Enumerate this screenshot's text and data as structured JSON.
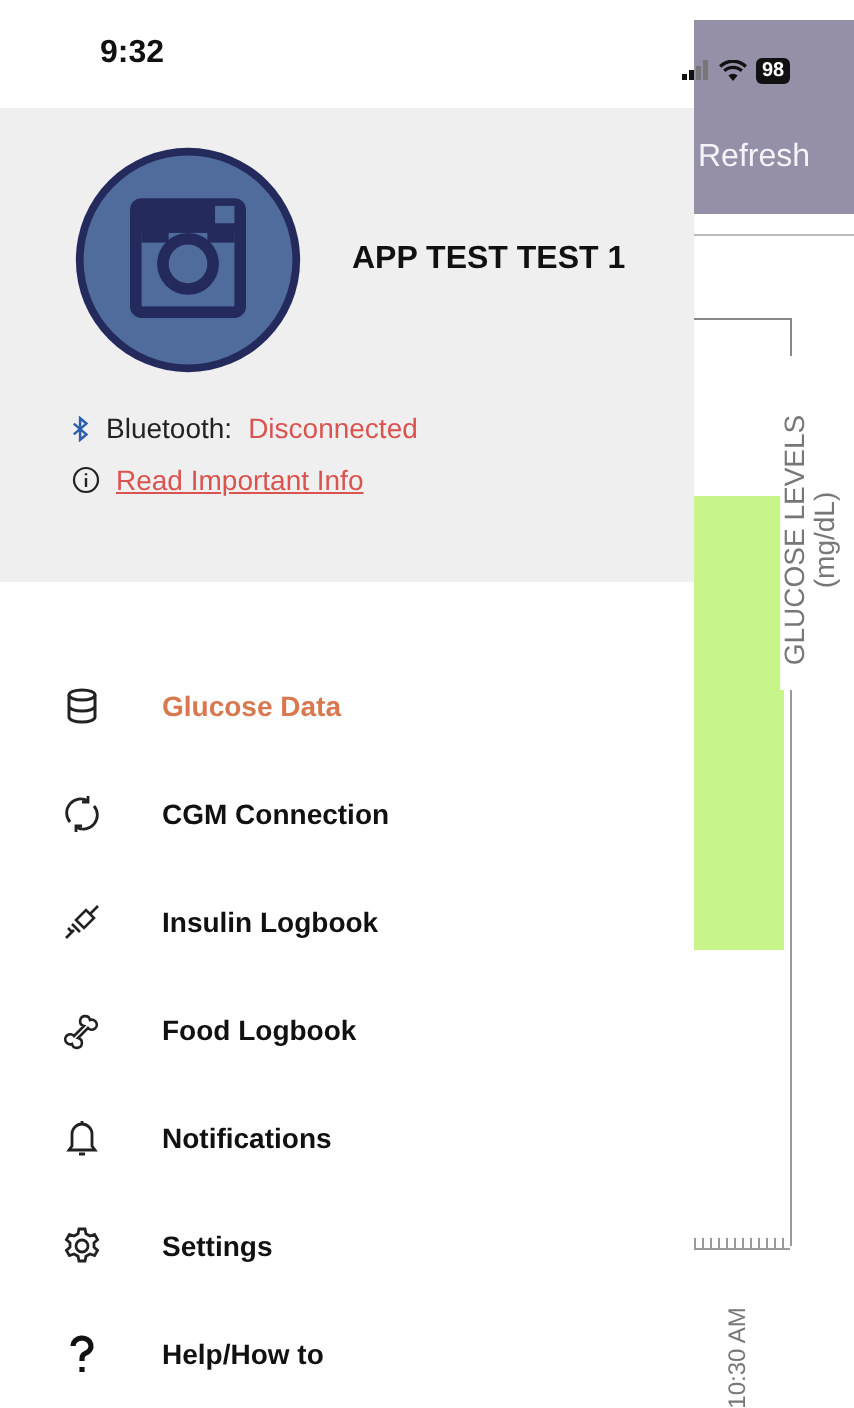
{
  "status_bar": {
    "time": "9:32",
    "battery": "98"
  },
  "header": {
    "action": "Refresh"
  },
  "profile": {
    "name": "APP TEST TEST 1",
    "bluetooth_label": "Bluetooth:",
    "bluetooth_status": "Disconnected",
    "info_link": "Read Important Info"
  },
  "menu": [
    {
      "label": "Glucose Data",
      "kind": "database",
      "selected": true
    },
    {
      "label": "CGM Connection",
      "kind": "sync",
      "selected": false
    },
    {
      "label": "Insulin Logbook",
      "kind": "syringe",
      "selected": false
    },
    {
      "label": "Food Logbook",
      "kind": "bone",
      "selected": false
    },
    {
      "label": "Notifications",
      "kind": "bell",
      "selected": false
    },
    {
      "label": "Settings",
      "kind": "gear",
      "selected": false
    },
    {
      "label": "Help/How to",
      "kind": "question",
      "selected": false
    }
  ],
  "chart": {
    "ylabel": "GLUCOSE LEVELS",
    "yunit": "(mg/dL)",
    "xtick": "10:30 AM"
  }
}
